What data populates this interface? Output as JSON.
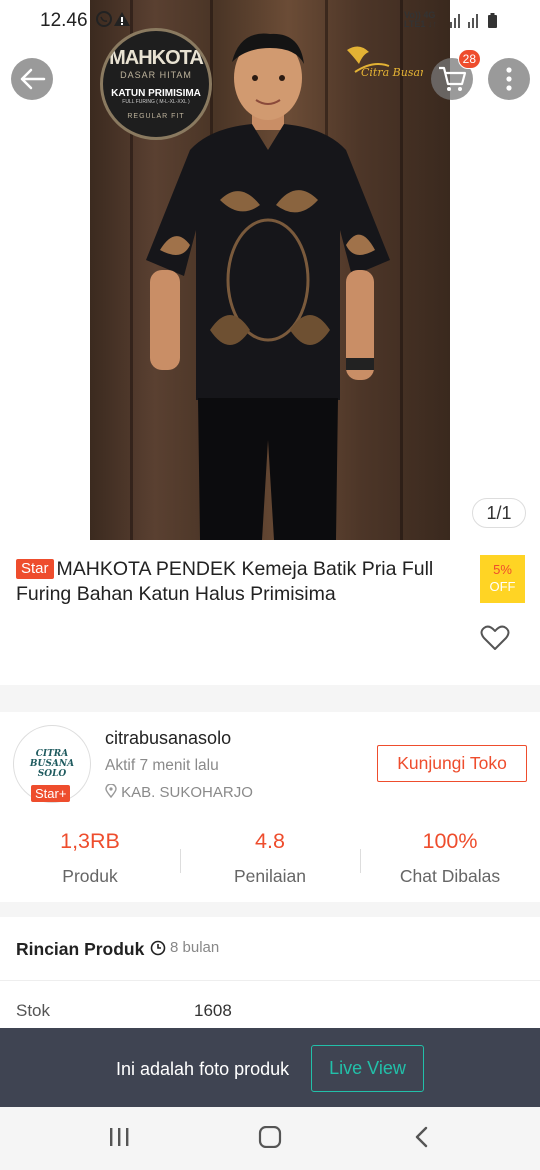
{
  "status_bar": {
    "time": "12.46",
    "network_line1": "Vo)) 4G",
    "network_line2": "LTE1 ↓↑"
  },
  "gallery": {
    "image_counter": "1/1",
    "photo_logo": {
      "line1": "MAHKOTA",
      "line2": "DASAR HITAM",
      "line3": "KATUN PRIMISIMA",
      "line4": "FULL FURING ( M-L-XL-XXL )",
      "line5": "REGULAR FIT"
    },
    "brand_watermark": "Citra Busana"
  },
  "header": {
    "cart_count": "28",
    "back_icon": "back-arrow-icon",
    "cart_icon": "cart-icon",
    "more_icon": "more-vertical-icon"
  },
  "product": {
    "badge": "Star",
    "title": "MAHKOTA PENDEK Kemeja Batik Pria Full Furing Bahan Katun Halus Primisima",
    "discount_percent": "5%",
    "discount_label": "OFF"
  },
  "shop": {
    "avatar_text": "CITRA BUSANA SOLO",
    "badge": "Star+",
    "name": "citrabusanasolo",
    "active": "Aktif 7 menit lalu",
    "location": "KAB. SUKOHARJO",
    "visit_label": "Kunjungi Toko",
    "stats": [
      {
        "value": "1,3RB",
        "label": "Produk"
      },
      {
        "value": "4.8",
        "label": "Penilaian"
      },
      {
        "value": "100%",
        "label": "Chat Dibalas"
      }
    ]
  },
  "details": {
    "title": "Rincian Produk",
    "time": "8 bulan",
    "stock_label": "Stok",
    "stock_value": "1608"
  },
  "banner": {
    "text": "Ini adalah foto produk",
    "button": "Live View"
  },
  "colors": {
    "accent": "#ee4d2d",
    "banner_bg": "#3f4452",
    "live_view": "#22c0a9",
    "discount_bg": "#ffd424"
  }
}
